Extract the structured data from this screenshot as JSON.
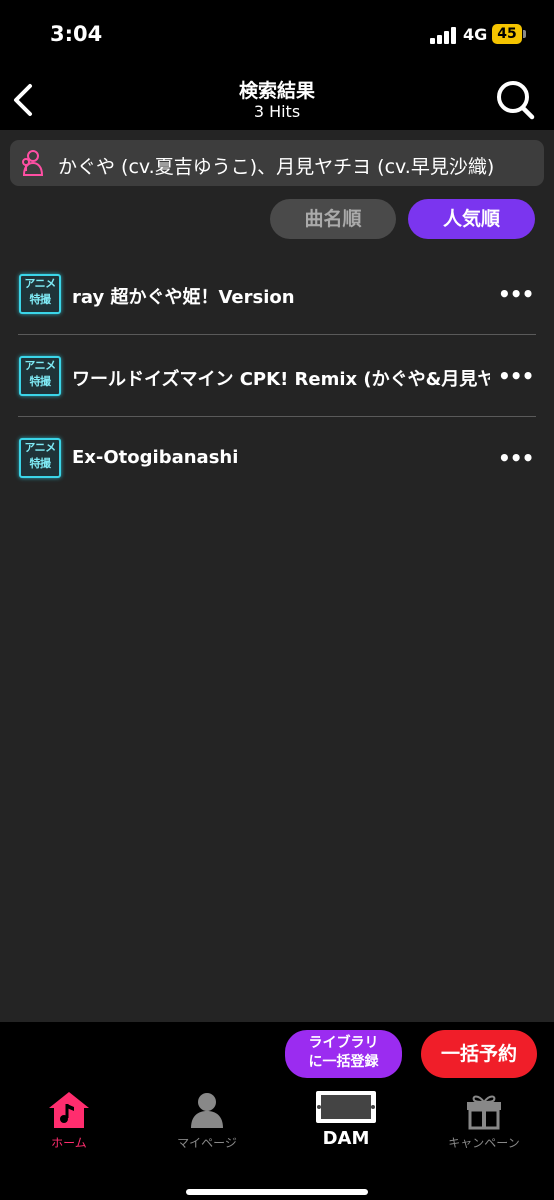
{
  "status": {
    "time": "3:04",
    "network": "4G",
    "battery": "45"
  },
  "header": {
    "title": "検索結果",
    "subtitle": "3 Hits"
  },
  "query": {
    "text": "かぐや (cv.夏吉ゆうこ)、月見ヤチヨ (cv.早見沙織)"
  },
  "sort": {
    "by_title": "曲名順",
    "by_popularity": "人気順",
    "active": "by_popularity"
  },
  "tag_label": {
    "line1": "アニメ",
    "line2": "特撮"
  },
  "results": [
    {
      "title": "ray 超かぐや姫！Version"
    },
    {
      "title": "ワールドイズマイン CPK! Remix (かぐや&月見ヤチヨ)"
    },
    {
      "title": "Ex-Otogibanashi"
    }
  ],
  "more_label": "•••",
  "actions": {
    "library_line1": "ライブラリ",
    "library_line2": "に一括登録",
    "reserve": "一括予約"
  },
  "tabs": [
    {
      "label": "ホーム",
      "icon": "home-music-icon",
      "active": true
    },
    {
      "label": "マイページ",
      "icon": "person-icon",
      "active": false
    },
    {
      "label": "DAM",
      "icon": "dam-logo-icon",
      "active": false
    },
    {
      "label": "キャンペーン",
      "icon": "gift-icon",
      "active": false
    }
  ],
  "colors": {
    "accent_purple": "#7b35ef",
    "reserve_red": "#f01e29",
    "home_pink": "#ff2d6e",
    "tag_cyan": "#3bd5e8"
  }
}
